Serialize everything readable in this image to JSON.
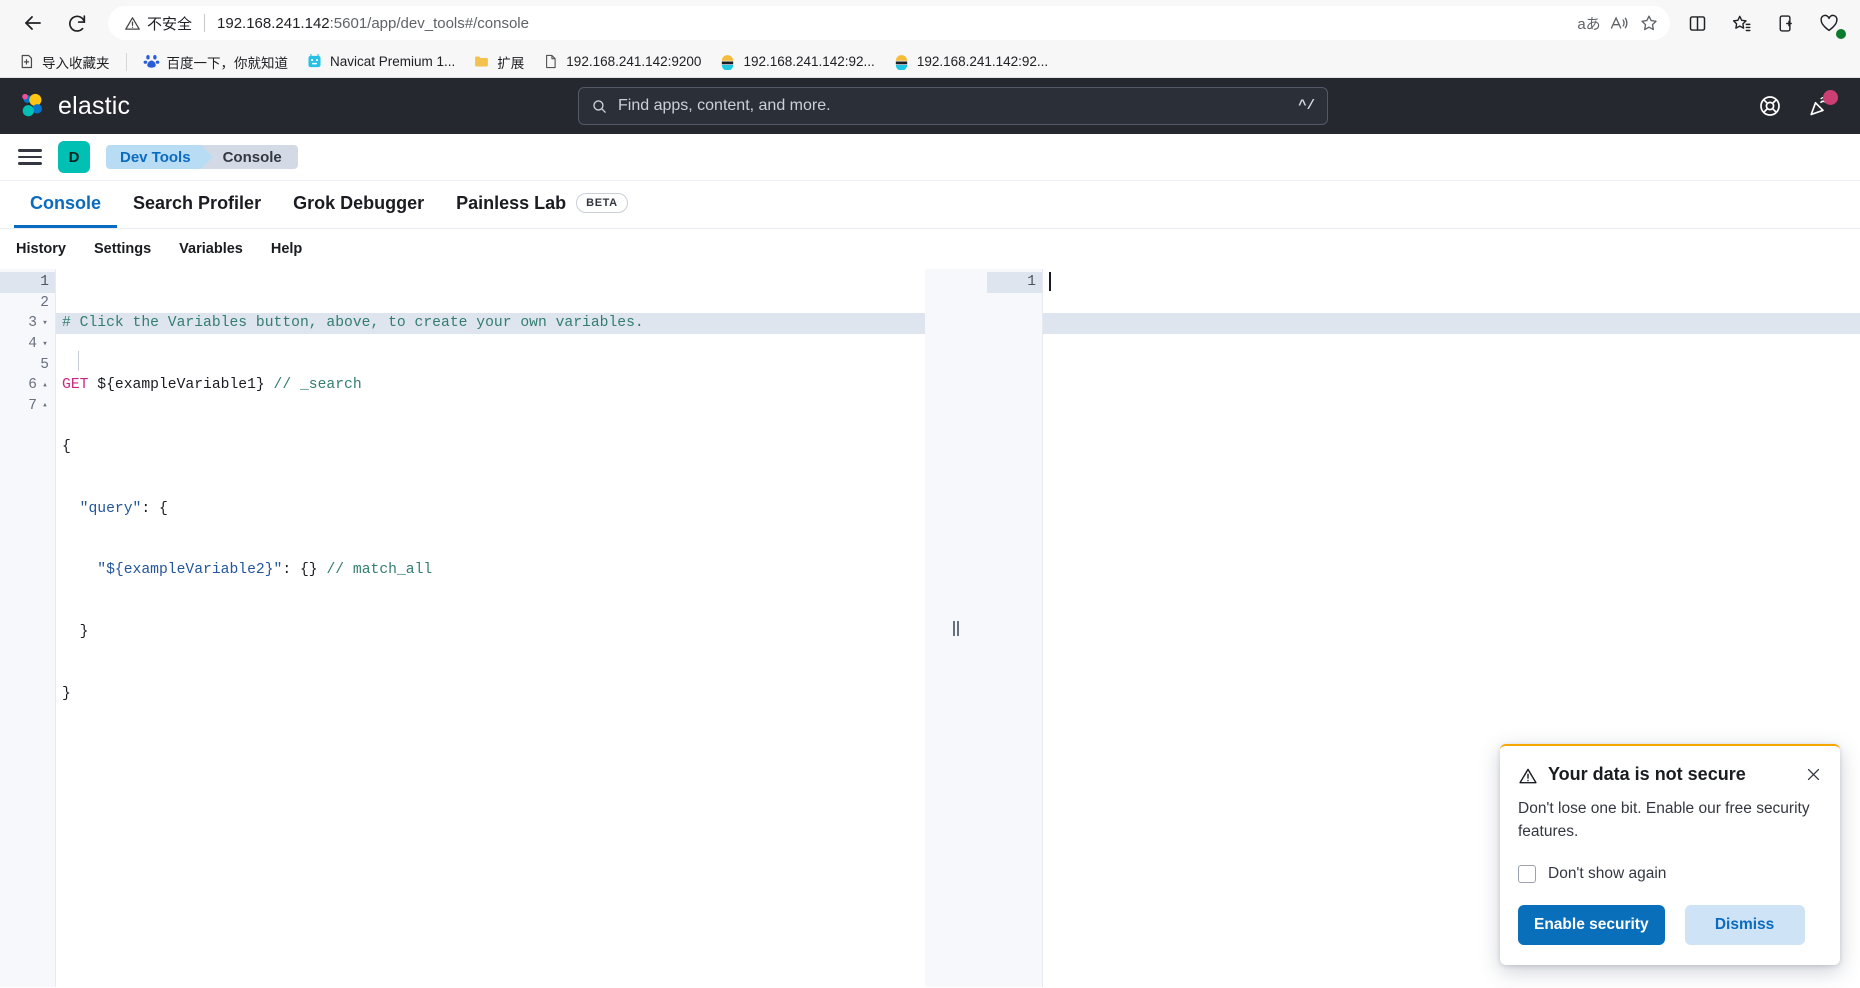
{
  "browser": {
    "back_label": "Back",
    "reload_label": "Reload",
    "security_label": "不安全",
    "url_host": "192.168.241.142",
    "url_rest": ":5601/app/dev_tools#/console",
    "omnibox_actions": [
      {
        "name": "translate-icon",
        "label": "aあ"
      },
      {
        "name": "read-aloud-icon",
        "label": "A"
      },
      {
        "name": "favorite-star-icon",
        "label": "☆"
      }
    ],
    "toolbar_icons": [
      {
        "name": "split-screen-icon"
      },
      {
        "name": "collections-icon"
      },
      {
        "name": "add-tab-group-icon"
      },
      {
        "name": "browser-essentials-icon"
      }
    ],
    "bookmarks": [
      {
        "label": "导入收藏夹",
        "icon": "import-bookmarks-icon"
      },
      {
        "label": "百度一下，你就知道",
        "icon": "baidu-icon"
      },
      {
        "label": "Navicat Premium 1...",
        "icon": "navicat-icon"
      },
      {
        "label": "扩展",
        "icon": "folder-icon"
      },
      {
        "label": "192.168.241.142:9200",
        "icon": "page-icon"
      },
      {
        "label": "192.168.241.142:92...",
        "icon": "kibana-icon"
      },
      {
        "label": "192.168.241.142:92...",
        "icon": "kibana-icon"
      }
    ]
  },
  "elastic_header": {
    "wordmark": "elastic",
    "search_placeholder": "Find apps, content, and more.",
    "search_shortcut": "^/",
    "right_icons": [
      {
        "name": "help-lifebuoy-icon"
      },
      {
        "name": "news-announcement-icon",
        "has_badge": true
      }
    ]
  },
  "breadcrumb_bar": {
    "menu_label": "Toggle navigation",
    "space_initial": "D",
    "crumbs": [
      {
        "label": "Dev Tools"
      },
      {
        "label": "Console"
      }
    ]
  },
  "tabs": [
    {
      "label": "Console",
      "active": true,
      "badge": ""
    },
    {
      "label": "Search Profiler",
      "active": false,
      "badge": ""
    },
    {
      "label": "Grok Debugger",
      "active": false,
      "badge": ""
    },
    {
      "label": "Painless Lab",
      "active": false,
      "badge": "BETA"
    }
  ],
  "console_subnav": [
    {
      "label": "History"
    },
    {
      "label": "Settings"
    },
    {
      "label": "Variables"
    },
    {
      "label": "Help"
    }
  ],
  "editor": {
    "left": {
      "line_numbers": [
        "1",
        "2",
        "3",
        "4",
        "5",
        "6",
        "7"
      ],
      "folds": [
        "",
        "",
        "▾",
        "▾",
        "",
        "▴",
        "▴"
      ],
      "current_line": 1,
      "lines": [
        "# Click the Variables button, above, to create your own variables.",
        "GET ${exampleVariable1} // _search",
        "{",
        "  \"query\": {",
        "    \"${exampleVariable2}\": {} // match_all",
        "  }",
        "}"
      ]
    },
    "right": {
      "line_numbers": [
        "1"
      ],
      "lines": [
        ""
      ]
    }
  },
  "toast": {
    "title": "Your data is not secure",
    "warning_icon": "warning-triangle-icon",
    "close_icon": "close-icon",
    "body": "Don't lose one bit. Enable our free security features.",
    "checkbox_label": "Don't show again",
    "primary_button": "Enable security",
    "secondary_button": "Dismiss"
  },
  "colors": {
    "elastic_dark": "#25282f",
    "accent_blue": "#0b6bbf",
    "space_teal": "#00bfb3",
    "toast_warning": "#f5a700",
    "badge_pink": "#cc3f72"
  }
}
